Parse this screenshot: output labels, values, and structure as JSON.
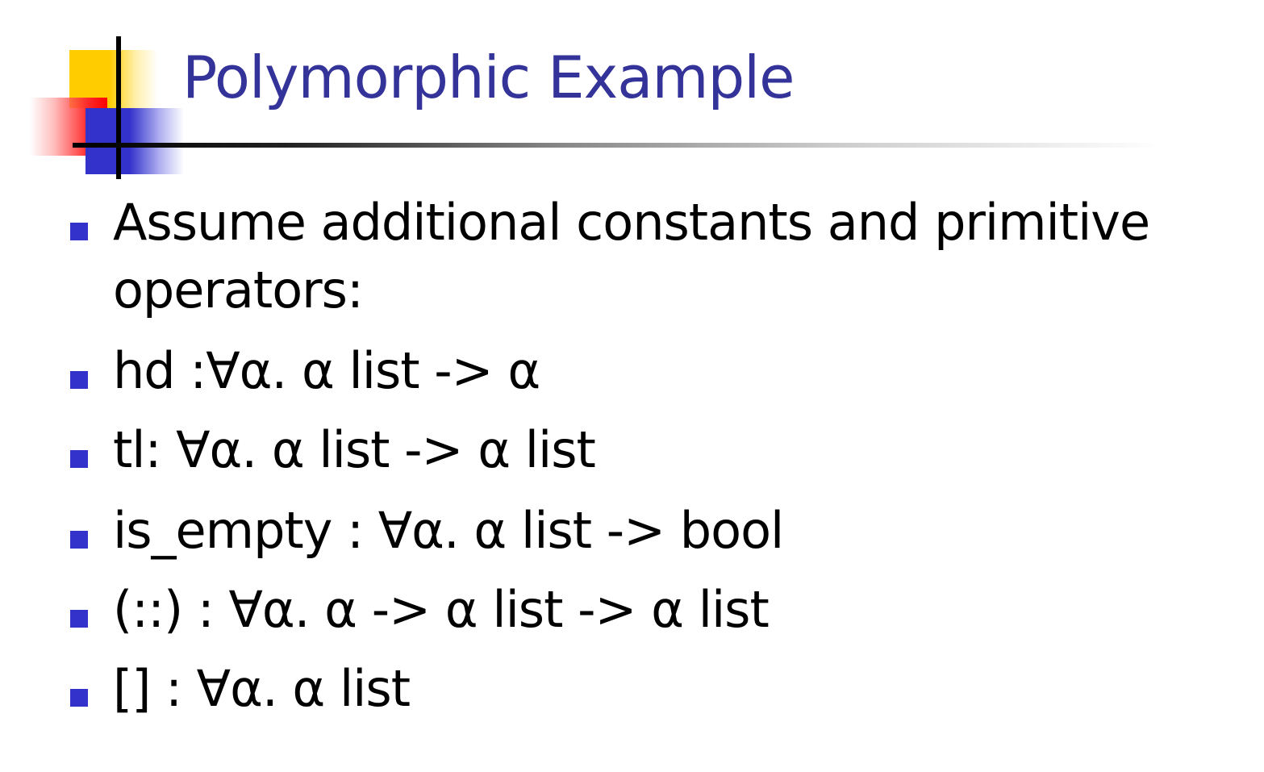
{
  "slide": {
    "title": "Polymorphic Example",
    "bullets": [
      {
        "text": "Assume additional constants and primitive operators:"
      },
      {
        "text": "hd :∀α. α list -> α"
      },
      {
        "text": "tl: ∀α. α list -> α list"
      },
      {
        "text": "is_empty : ∀α. α list -> bool"
      },
      {
        "text": "(::) : ∀α. α -> α list -> α list"
      },
      {
        "text": "[] : ∀α. α list"
      }
    ]
  },
  "colors": {
    "title": "#333399",
    "bullet_marker": "#3333cc",
    "body_text": "#000000",
    "deco_yellow": "#ffcc00",
    "deco_red": "#ff0000",
    "deco_blue": "#3333cc"
  },
  "icons": {
    "bullet": "square-bullet-icon"
  }
}
